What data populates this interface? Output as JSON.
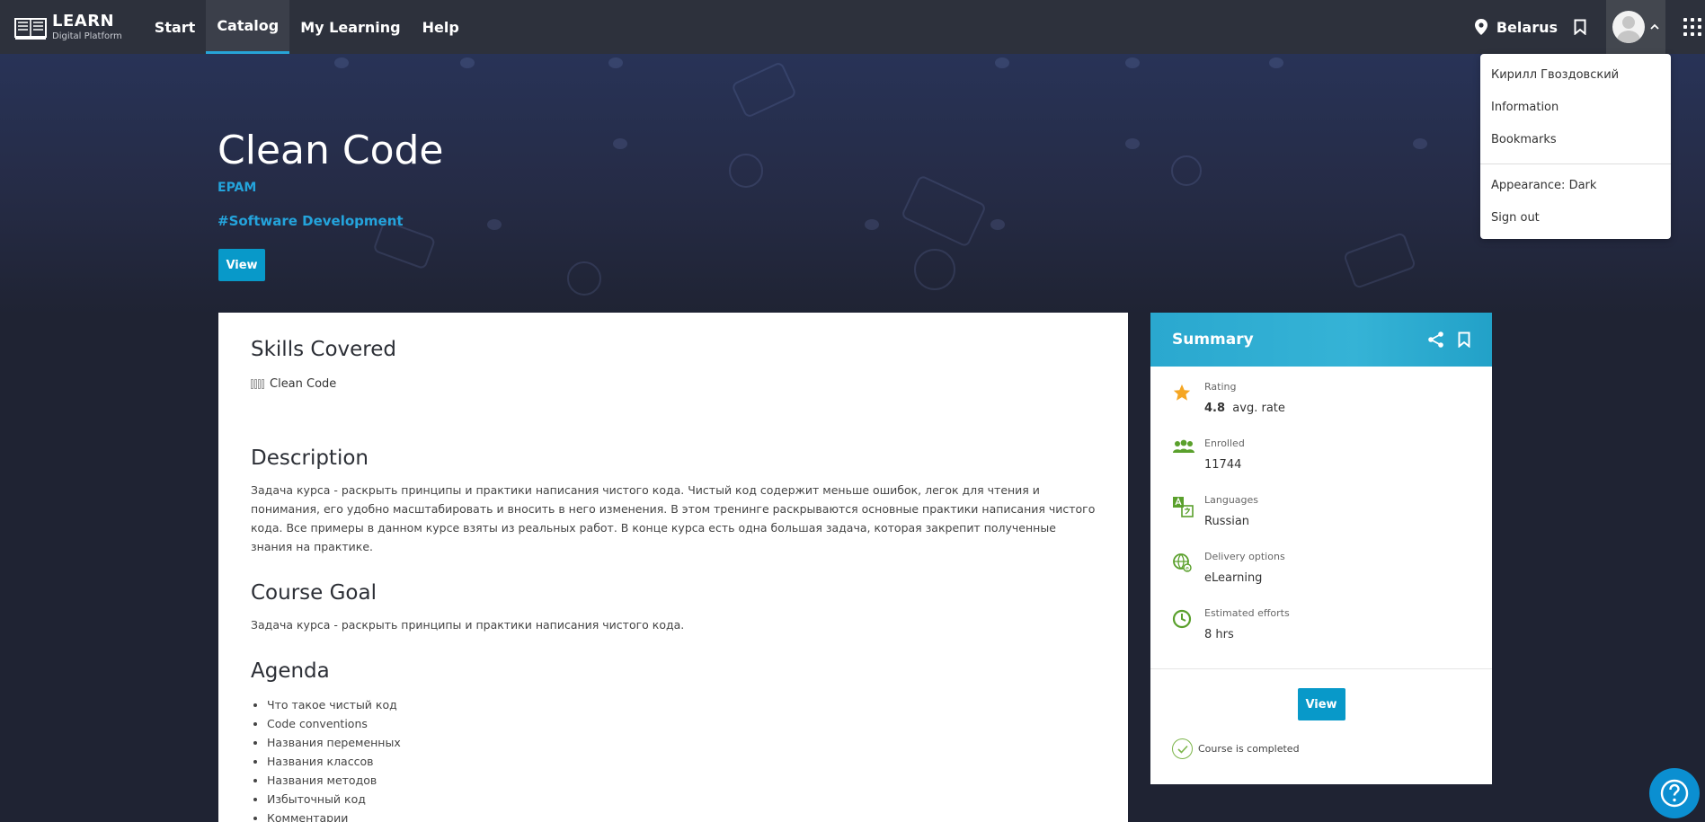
{
  "nav": {
    "logo_title": "LEARN",
    "logo_subtitle": "Digital Platform",
    "links": [
      "Start",
      "Catalog",
      "My Learning",
      "Help"
    ],
    "active": "Catalog",
    "location": "Belarus"
  },
  "hero": {
    "title": "Clean Code",
    "provider": "EPAM",
    "tag": "#Software Development",
    "view_label": "View"
  },
  "main": {
    "skills_heading": "Skills Covered",
    "skill": "Clean Code",
    "description_heading": "Description",
    "description": " Задача курса - раскрыть принципы и практики написания чистого кода. Чистый код содержит меньше ошибок, легок для чтения и понимания, его удобно масштабировать и вносить в него изменения. В этом тренинге раскрываются основные практики написания чистого кода. Все примеры в данном курсе взяты из реальных работ. В конце курса есть одна большая задача, которая закрепит полученные знания на практике.",
    "goal_heading": "Course Goal",
    "goal": "Задача курса - раскрыть принципы и практики написания чистого кода.",
    "agenda_heading": "Agenda",
    "agenda": [
      "Что такое чистый код",
      "Code conventions",
      "Названия переменных",
      "Названия классов",
      "Названия методов",
      "Избыточный код",
      "Комментарии"
    ]
  },
  "summary": {
    "title": "Summary",
    "rating_label": "Rating",
    "rating_value": "4.8",
    "rating_suffix": "avg. rate",
    "enrolled_label": "Enrolled",
    "enrolled_value": "11744",
    "languages_label": "Languages",
    "languages_value": "Russian",
    "delivery_label": "Delivery options",
    "delivery_value": "eLearning",
    "efforts_label": "Estimated efforts",
    "efforts_value": "8 hrs",
    "view_label": "View",
    "completed": "Course is completed"
  },
  "user_menu": {
    "name": "Кирилл Гвоздовский",
    "information": "Information",
    "bookmarks": "Bookmarks",
    "appearance": "Appearance: Dark",
    "sign_out": "Sign out"
  },
  "colors": {
    "nav_bg": "#2d313c",
    "accent": "#0899c9",
    "link": "#24a4dc",
    "star": "#f5a623",
    "green_icon": "#5aa02c"
  },
  "icons": [
    "book-logo-icon",
    "location-pin-icon",
    "bookmark-icon",
    "avatar-icon",
    "chevron-up-icon",
    "apps-grid-icon",
    "share-icon",
    "star-icon",
    "people-icon",
    "languages-icon",
    "delivery-icon",
    "clock-icon",
    "check-circle-icon",
    "help-icon"
  ]
}
